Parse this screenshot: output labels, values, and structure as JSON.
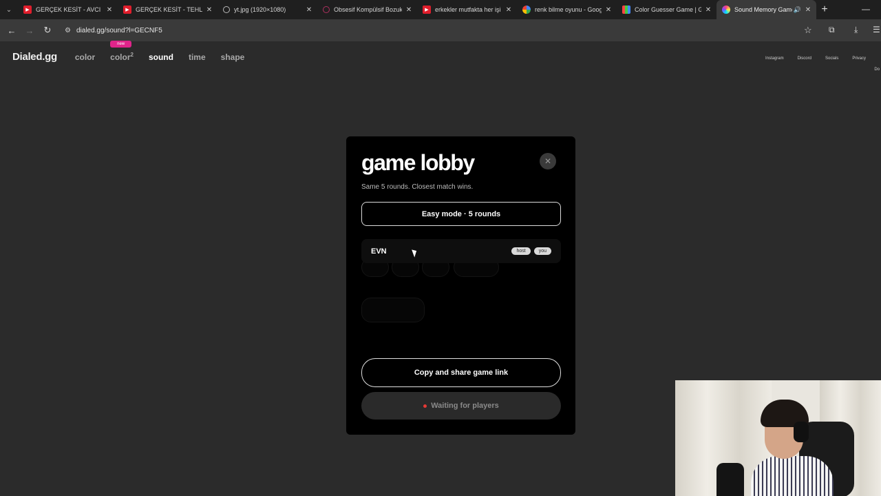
{
  "browser": {
    "tabs": [
      {
        "title": "GERÇEK KESİT - AVCI - Yo",
        "icon": "youtube-icon",
        "active": false
      },
      {
        "title": "GERÇEK KESİT - TEHLİKELİ",
        "icon": "youtube-icon",
        "active": false
      },
      {
        "title": "yt.jpg (1920×1080)",
        "icon": "globe-icon",
        "active": false
      },
      {
        "title": "Obsesif Kompülsif Bozukl",
        "icon": "ocd-icon",
        "active": false
      },
      {
        "title": "erkekler mutfakta her işi y",
        "icon": "youtube-icon",
        "active": false
      },
      {
        "title": "renk bilme oyunu - Googl",
        "icon": "google-icon",
        "active": false
      },
      {
        "title": "Color Guesser Game | Gu",
        "icon": "color-guesser-icon",
        "active": false
      },
      {
        "title": "Sound Memory Game",
        "icon": "sound-memory-icon",
        "active": true
      }
    ],
    "url": "dialed.gg/sound?l=GECNF5"
  },
  "site": {
    "logo": "Dialed.gg",
    "nav": {
      "color": "color",
      "color2": "color",
      "color2_sup": "2",
      "new_badge": "new",
      "sound": "sound",
      "time": "time",
      "shape": "shape"
    },
    "ext_links": [
      "Instagram",
      "Discord",
      "Socials",
      "Privacy"
    ],
    "ext_extra": "Do"
  },
  "modal": {
    "title": "game lobby",
    "subtitle": "Same 5 rounds. Closest match wins.",
    "mode": "Easy mode · 5 rounds",
    "player": {
      "name": "EVN",
      "tags": [
        "host",
        "you"
      ]
    },
    "copy_button": "Copy and share game link",
    "waiting": "Waiting for players"
  },
  "colors": {
    "accent_new": "#e0248a",
    "modal_bg": "#000000",
    "page_bg": "#2b2b2b",
    "waiting_dot": "#e53935"
  }
}
